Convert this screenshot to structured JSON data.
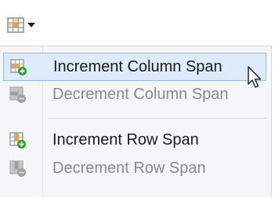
{
  "toolbar": {
    "button_icon": "table-span-icon",
    "dropdown_icon": "dropdown-arrow-icon"
  },
  "menu": {
    "items": [
      {
        "label": "Increment Column Span",
        "icon": "add-column-span-icon",
        "enabled": true,
        "hovered": true
      },
      {
        "label": "Decrement Column Span",
        "icon": "remove-column-span-icon",
        "enabled": false,
        "hovered": false
      },
      {
        "label": "Increment Row Span",
        "icon": "add-row-span-icon",
        "enabled": true,
        "hovered": false
      },
      {
        "label": "Decrement Row Span",
        "icon": "remove-row-span-icon",
        "enabled": false,
        "hovered": false
      }
    ]
  },
  "colors": {
    "hover_background": "#dcecfb",
    "hover_border": "#8cbdf0",
    "disabled_text": "#8a8a8a",
    "plus_green": "#2e9e2e",
    "cell_orange": "#f2a23a"
  }
}
